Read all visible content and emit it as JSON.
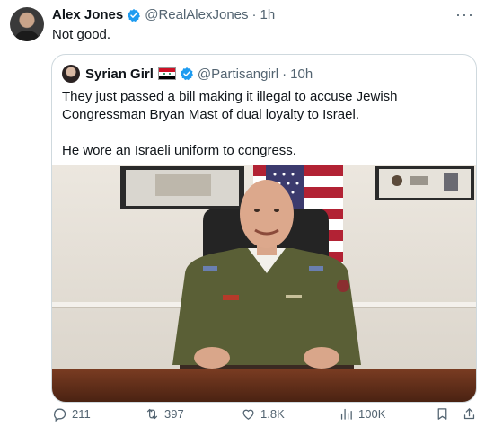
{
  "tweet": {
    "author_name": "Alex Jones",
    "author_handle": "@RealAlexJones",
    "separator": "·",
    "time": "1h",
    "text": "Not good.",
    "more_label": "···"
  },
  "quoted": {
    "author_name": "Syrian Girl",
    "author_handle": "@Partisangirl",
    "separator": "·",
    "time": "10h",
    "paragraph_1": "They just passed a bill making it illegal to accuse Jewish Congressman Bryan Mast of dual loyalty to Israel.",
    "paragraph_2": "He wore an Israeli uniform to congress."
  },
  "stats": {
    "replies": "211",
    "reposts": "397",
    "likes": "1.8K",
    "views": "100K"
  },
  "colors": {
    "verified": "#1d9bf0",
    "muted": "#536471",
    "border": "#cfd9de",
    "uniform": "#5a5f36"
  },
  "icons": [
    "verified-badge-icon",
    "more-icon",
    "syrian-flag-icon",
    "reply-icon",
    "repost-icon",
    "like-icon",
    "views-icon",
    "bookmark-icon",
    "share-icon"
  ]
}
